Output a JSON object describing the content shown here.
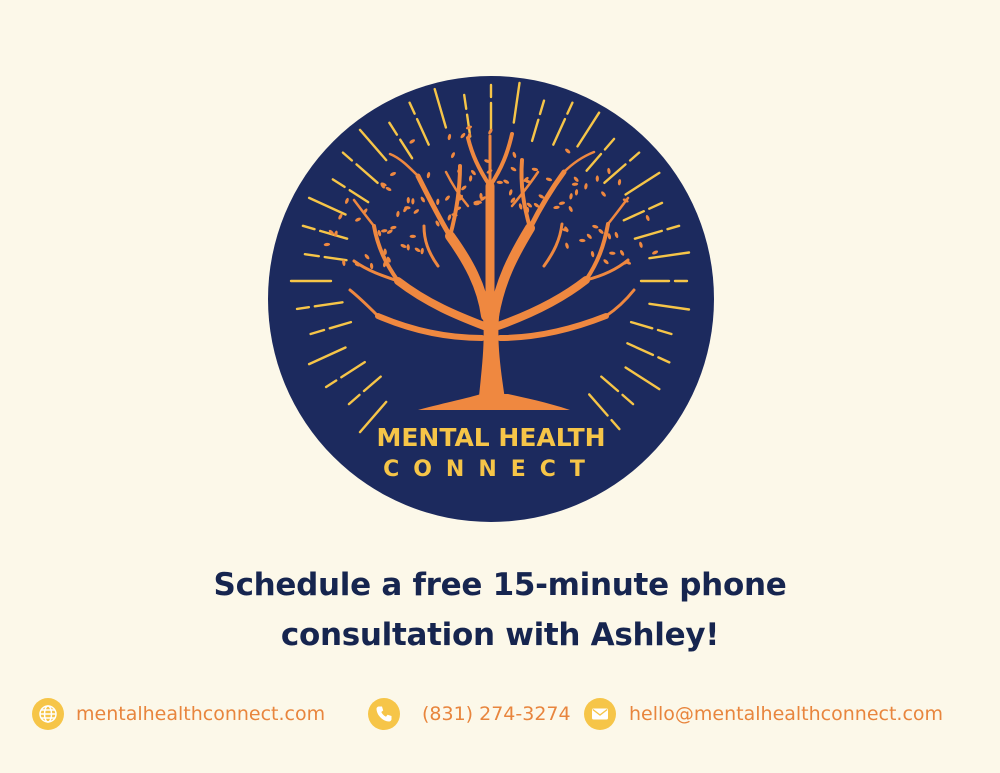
{
  "brand": {
    "line1": "MENTAL HEALTH",
    "line2": "CONNECT"
  },
  "headline": {
    "line1": "Schedule a free 15-minute phone",
    "line2": "consultation with Ashley!"
  },
  "contacts": {
    "website": {
      "icon": "globe-icon",
      "text": "mentalhealthconnect.com"
    },
    "phone": {
      "icon": "phone-icon",
      "text": "(831) 274-3274"
    },
    "email": {
      "icon": "envelope-icon",
      "text": "hello@mentalhealthconnect.com"
    }
  },
  "colors": {
    "background": "#fcf8e9",
    "navy": "#1c2a5e",
    "orange": "#ef8840",
    "yellow": "#f6c548",
    "headline": "#16254f"
  }
}
